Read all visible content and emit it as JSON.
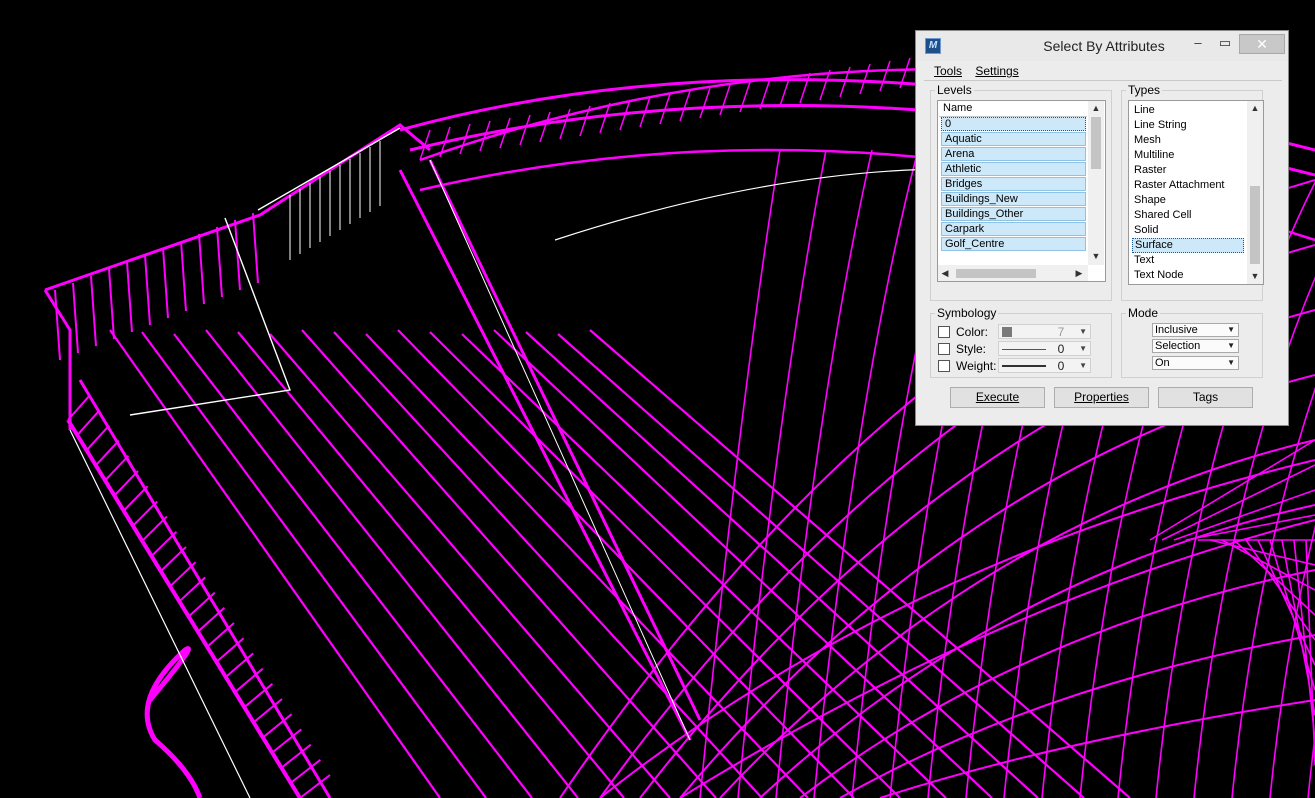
{
  "colors": {
    "wireframe": "#ff00ff",
    "background": "#000000",
    "highlight": "#ffffff"
  },
  "dialog": {
    "title": "Select By Attributes",
    "app_icon": "microstation-icon",
    "menu": {
      "tools": "Tools",
      "settings": "Settings"
    },
    "levels": {
      "group_label": "Levels",
      "header": "Name",
      "items": [
        "0",
        "Aquatic",
        "Arena",
        "Athletic",
        "Bridges",
        "Buildings_New",
        "Buildings_Other",
        "Carpark",
        "Golf_Centre"
      ]
    },
    "types": {
      "group_label": "Types",
      "items": [
        "Line",
        "Line String",
        "Mesh",
        "Multiline",
        "Raster",
        "Raster Attachment",
        "Shape",
        "Shared Cell",
        "Solid",
        "Surface",
        "Text",
        "Text Node"
      ],
      "selected": "Surface"
    },
    "symbology": {
      "group_label": "Symbology",
      "color_label": "Color:",
      "color_value": "7",
      "style_label": "Style:",
      "style_value": "0",
      "weight_label": "Weight:",
      "weight_value": "0"
    },
    "mode": {
      "group_label": "Mode",
      "mode_value": "Inclusive",
      "selection_value": "Selection",
      "state_value": "On"
    },
    "buttons": {
      "execute": "Execute",
      "properties": "Properties",
      "tags": "Tags"
    }
  }
}
